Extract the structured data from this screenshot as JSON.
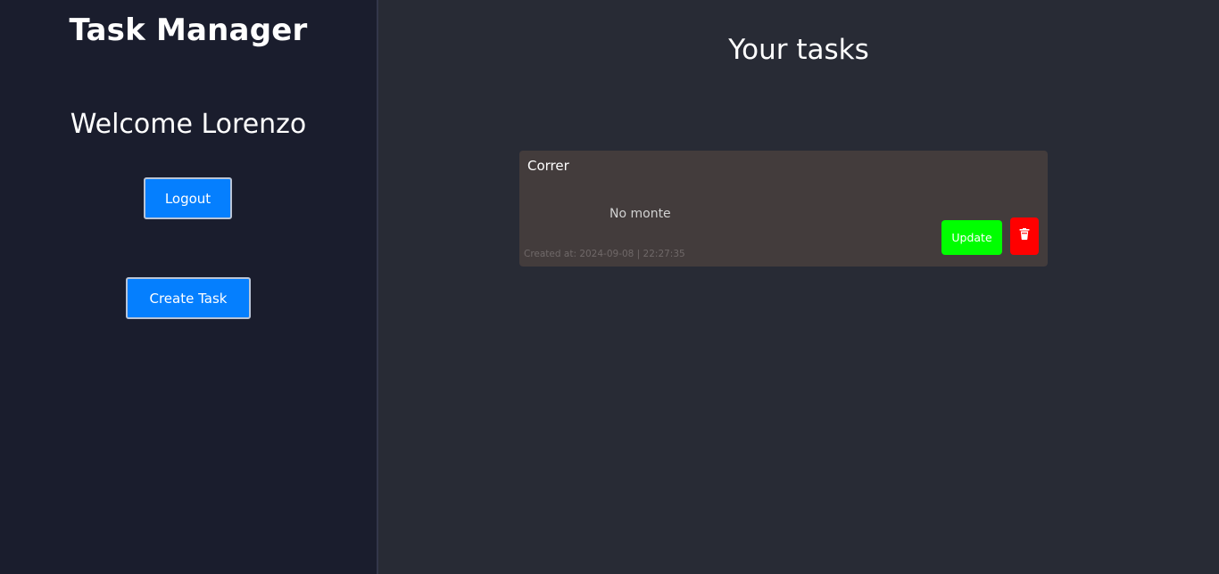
{
  "sidebar": {
    "app_title": "Task Manager",
    "welcome_text": "Welcome Lorenzo",
    "logout_label": "Logout",
    "create_task_label": "Create Task"
  },
  "main": {
    "heading": "Your tasks",
    "tasks": [
      {
        "title": "Correr",
        "description": "No monte",
        "created_at": "Created at: 2024-09-08 | 22:27:35",
        "update_label": "Update",
        "delete_icon": "trash-icon"
      }
    ]
  },
  "colors": {
    "sidebar_bg": "#1a1d2d",
    "main_bg": "#282b35",
    "primary_button": "#057ffe",
    "card_bg": "#433c3c",
    "update_button": "#00ff00",
    "delete_button": "#ff0000"
  }
}
